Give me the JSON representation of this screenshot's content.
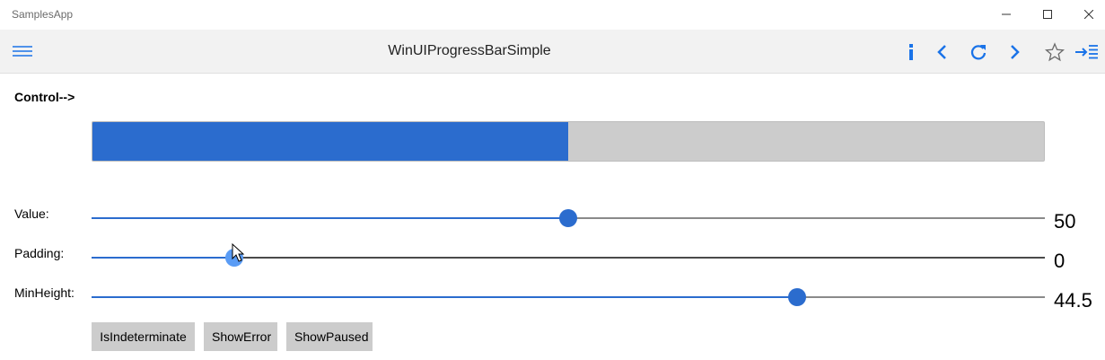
{
  "window": {
    "app_title": "SamplesApp"
  },
  "header": {
    "title": "WinUIProgressBarSimple",
    "icons": [
      "hamburger-menu-icon",
      "info-icon",
      "back-icon",
      "refresh-icon",
      "forward-icon",
      "favorite-star-icon",
      "pin-pane-icon"
    ],
    "accent_color": "#1a73e8"
  },
  "content": {
    "control_label": "Control-->",
    "progress": {
      "value": 50,
      "max": 100,
      "fill_color": "#2b6cce",
      "track_color": "#cccccc"
    },
    "sliders": [
      {
        "label": "Value:",
        "value": "50",
        "fraction": 0.5
      },
      {
        "label": "Padding:",
        "value": "0",
        "fraction": 0.15
      },
      {
        "label": "MinHeight:",
        "value": "44.5",
        "fraction": 0.74
      }
    ],
    "buttons": {
      "indeterminate": "IsIndeterminate",
      "error": "ShowError",
      "paused": "ShowPaused"
    }
  }
}
